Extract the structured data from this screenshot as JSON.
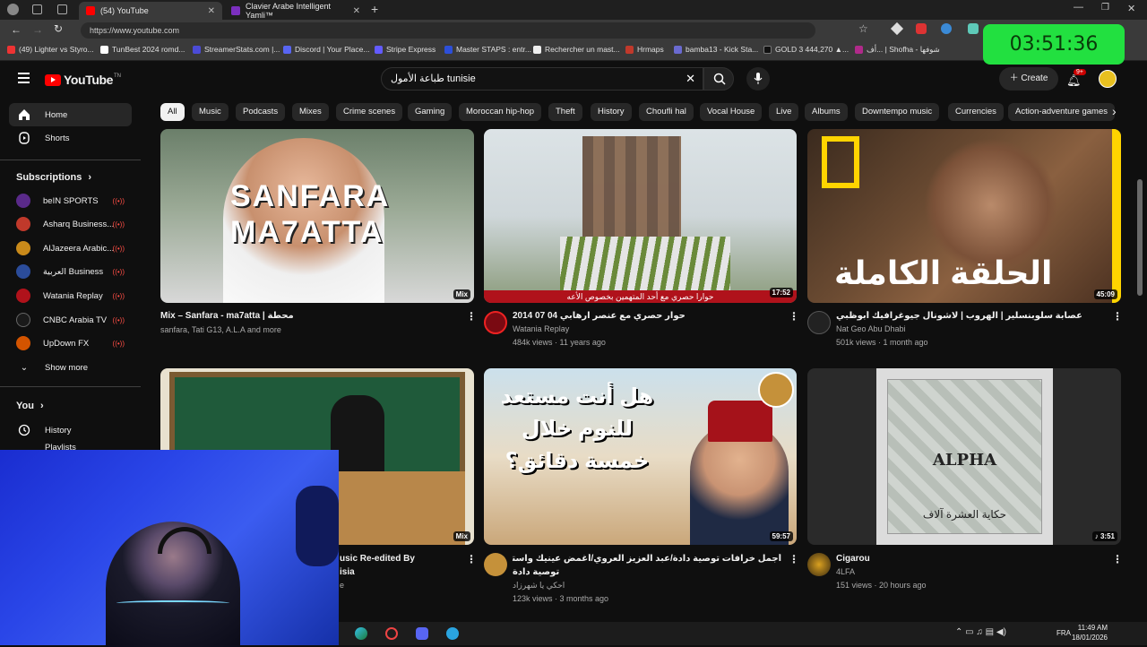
{
  "browser": {
    "tabs": [
      {
        "label": "(54) YouTube",
        "active": true
      },
      {
        "label": "Clavier Arabe Intelligent Yamli™",
        "active": false
      }
    ],
    "url": "https://www.youtube.com",
    "bookmarks": [
      "(49) Lighter vs Styro...",
      "TunBest 2024 romd...",
      "StreamerStats.com |...",
      "Discord | Your Place...",
      "Stripe Express",
      "Master STAPS : entr...",
      "Rechercher un mast...",
      "Hrmaps",
      "bamba13 - Kick Sta...",
      "GOLD 3 444,270 ▲...",
      "أف... | Shofha - شوفها"
    ],
    "timer": "03:51:36"
  },
  "youtube": {
    "logo_text": "YouTube",
    "logo_suffix": "TN",
    "search_value": "طباعة الأمول tunisie",
    "create_label": "Create",
    "notif_badge": "9+",
    "sidebar": {
      "home": "Home",
      "shorts": "Shorts",
      "subscriptions_title": "Subscriptions",
      "channels": [
        {
          "name": "beIN SPORTS",
          "color": "#5a2a8a"
        },
        {
          "name": "Asharq Business...",
          "color": "#c0392b"
        },
        {
          "name": "AlJazeera Arabic...",
          "color": "#c98a1a"
        },
        {
          "name": "العربية Business",
          "color": "#2b4c9a"
        },
        {
          "name": "Watania Replay",
          "color": "#b0121b"
        },
        {
          "name": "CNBC Arabia TV",
          "color": "#1a1a1a"
        },
        {
          "name": "UpDown FX",
          "color": "#d35400"
        }
      ],
      "show_more": "Show more",
      "you_title": "You",
      "history": "History",
      "playlists": "Playlists"
    },
    "chips": [
      "All",
      "Music",
      "Podcasts",
      "Mixes",
      "Crime scenes",
      "Gaming",
      "Moroccan hip-hop",
      "Theft",
      "History",
      "Choufli hal",
      "Vocal House",
      "Live",
      "Albums",
      "Downtempo music",
      "Currencies",
      "Action-adventure games"
    ],
    "videos": [
      {
        "title": "Mix – Sanfara - ma7atta | محطة",
        "meta1": "sanfara, Tati G13, A.L.A and more",
        "meta2": "",
        "duration": "Mix",
        "thumb_text": "SANFARA\nMA7ATTA"
      },
      {
        "title": "حوار حصري مع عنصر ارهابي 04 07 2014",
        "meta1": "Watania Replay",
        "meta2": "484k views · 11 years ago",
        "duration": "17:52",
        "thumb_caption": "حوارا حصري مع أحد المتهمين بخصوص الأعه"
      },
      {
        "title": "عصابة سلوبنسلير | الهروب | لاشونال جيوغرافيك أبوظبي",
        "meta1": "Nat Geo Abu Dhabi",
        "meta2": "501k views · 1 month ago",
        "duration": "45:09",
        "thumb_text": "الحلقة الكاملة"
      },
      {
        "title": "usic Re-edited By",
        "title2": "isia",
        "meta1": "e",
        "meta2": "",
        "duration": "Mix"
      },
      {
        "title": "أجمل خرافات توصية دادة/عبد العزيز العروي/أغمض عينيك واستمع لأجمل خرافات",
        "title2": "توصية دادة",
        "meta1": "احكي يا شهرزاد",
        "meta2": "123k views · 3 months ago",
        "duration": "59:57",
        "thumb_text": "هل أنت مستعد للنوم خلال خمسة دقائق؟"
      },
      {
        "title": "Cigarou",
        "meta1": "4LFA",
        "meta2": "151 views · 20 hours ago",
        "duration": "3:51",
        "thumb_text": "ALPHA",
        "thumb_caption": "حكاية العشرة آلاف"
      }
    ]
  },
  "taskbar": {
    "lang": "FRA",
    "time": "11:49 AM",
    "date": "18/01/2026"
  }
}
